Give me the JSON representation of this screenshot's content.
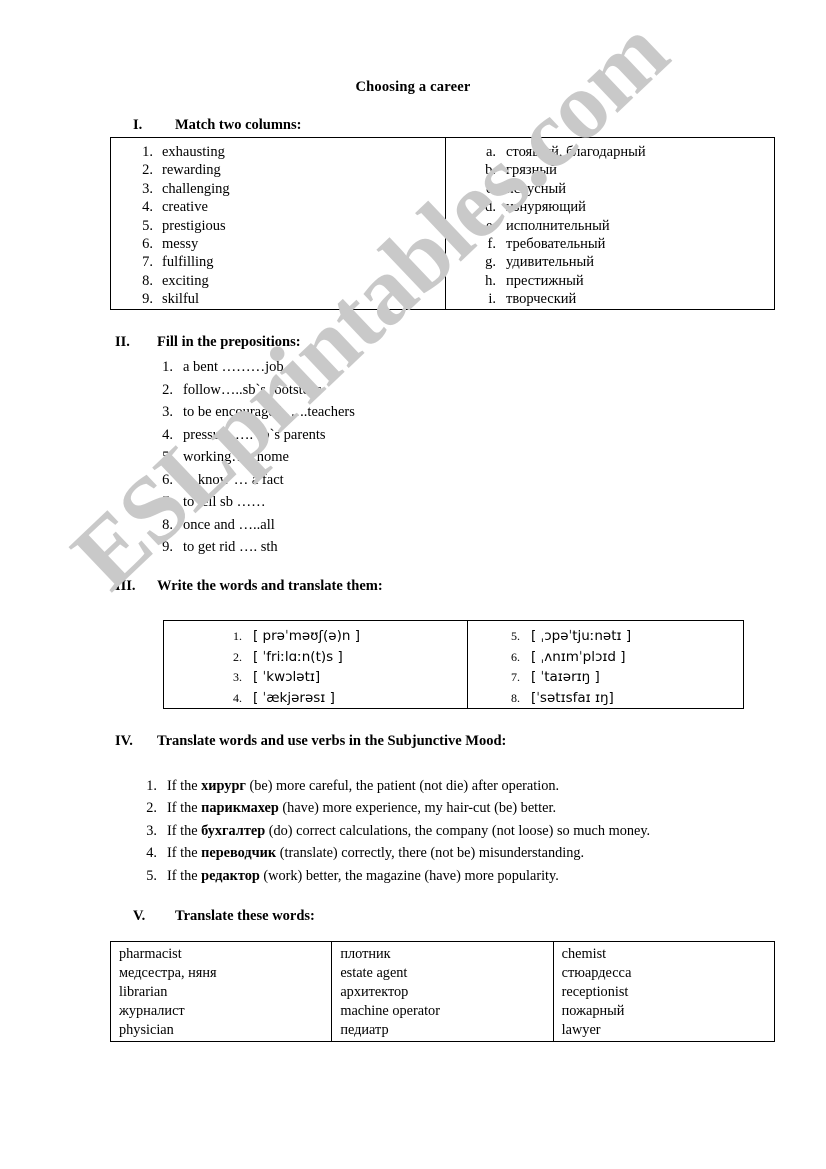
{
  "document": {
    "title": "Choosing a career",
    "watermark": "ESLprintables.com"
  },
  "sections": {
    "one": {
      "numeral": "I.",
      "heading": "Match two columns:",
      "left_items": [
        {
          "marker": "1.",
          "text": "exhausting"
        },
        {
          "marker": "2.",
          "text": "rewarding"
        },
        {
          "marker": "3.",
          "text": "challenging"
        },
        {
          "marker": "4.",
          "text": "creative"
        },
        {
          "marker": "5.",
          "text": "prestigious"
        },
        {
          "marker": "6.",
          "text": "messy"
        },
        {
          "marker": "7.",
          "text": "fulfilling"
        },
        {
          "marker": "8.",
          "text": "exciting"
        },
        {
          "marker": "9.",
          "text": "skilful"
        }
      ],
      "right_items": [
        {
          "marker": "a.",
          "text": "стоящий, благодарный"
        },
        {
          "marker": "b.",
          "text": "грязный"
        },
        {
          "marker": "c.",
          "text": "искусный"
        },
        {
          "marker": "d.",
          "text": "изнуряющий"
        },
        {
          "marker": "e.",
          "text": "исполнительный"
        },
        {
          "marker": "f.",
          "text": "требовательный"
        },
        {
          "marker": "g.",
          "text": "удивительный"
        },
        {
          "marker": "h.",
          "text": "престижный"
        },
        {
          "marker": "i.",
          "text": "творческий"
        }
      ]
    },
    "two": {
      "numeral": "II.",
      "heading": "Fill in the prepositions:",
      "items": [
        {
          "marker": "1.",
          "text": "a bent ………job"
        },
        {
          "marker": "2.",
          "text": "follow…..sb`s footsteps"
        },
        {
          "marker": "3.",
          "text": "to be encouraged …..teachers"
        },
        {
          "marker": "4.",
          "text": "pressure …. sb`s parents"
        },
        {
          "marker": "5.",
          "text": "working….. home"
        },
        {
          "marker": "6.",
          "text": "to know … a fact"
        },
        {
          "marker": "7.",
          "text": "to tell sb ……"
        },
        {
          "marker": "8.",
          "text": "once and …..all"
        },
        {
          "marker": "9.",
          "text": "to get rid …. sth"
        }
      ]
    },
    "three": {
      "numeral": "III.",
      "heading": "Write the words and translate them:",
      "left_items": [
        {
          "marker": "1.",
          "text": "[ prəˈməʊʃ(ə)n ]"
        },
        {
          "marker": "2.",
          "text": "[ ˈfriːlɑːn(t)s ]"
        },
        {
          "marker": "3.",
          "text": "[ ˈkwɔlətɪ]"
        },
        {
          "marker": "4.",
          "text": "[ ˈækjərəsɪ ]"
        }
      ],
      "right_items": [
        {
          "marker": "5.",
          "text": "[ ˌɔpəˈtjuːnətɪ ]"
        },
        {
          "marker": "6.",
          "text": "[ ˌʌnɪmˈplɔɪd ]"
        },
        {
          "marker": "7.",
          "text": "[ ˈtaɪərɪŋ ]"
        },
        {
          "marker": "8.",
          "text": "[ˈsətɪsfaɪ ɪŋ]"
        }
      ]
    },
    "four": {
      "numeral": "IV.",
      "heading": "Translate words and use verbs in the Subjunctive Mood:",
      "items": [
        {
          "marker": "1.",
          "pre": "If the ",
          "bold": "хирург",
          "post": " (be) more careful, the patient (not die) after operation."
        },
        {
          "marker": "2.",
          "pre": "If the ",
          "bold": "парикмахер",
          "post": " (have) more experience, my hair-cut (be) better."
        },
        {
          "marker": "3.",
          "pre": "If the ",
          "bold": "бухгалтер",
          "post": " (do) correct calculations, the company (not loose) so much money."
        },
        {
          "marker": "4.",
          "pre": "If the ",
          "bold": "переводчик",
          "post": " (translate) correctly, there (not be) misunderstanding."
        },
        {
          "marker": "5.",
          "pre": "If the ",
          "bold": "редактор",
          "post": " (work) better, the magazine (have) more popularity."
        }
      ]
    },
    "five": {
      "numeral": "V.",
      "heading": "Translate these words:",
      "column_1": [
        "pharmacist",
        "медсестра, няня",
        "librarian",
        "журналист",
        "physician"
      ],
      "column_2": [
        "плотник",
        "estate agent",
        "архитектор",
        "machine operator",
        "педиатр"
      ],
      "column_3": [
        "chemist",
        "стюардесса",
        "receptionist",
        "пожарный",
        "lawyer"
      ]
    }
  }
}
